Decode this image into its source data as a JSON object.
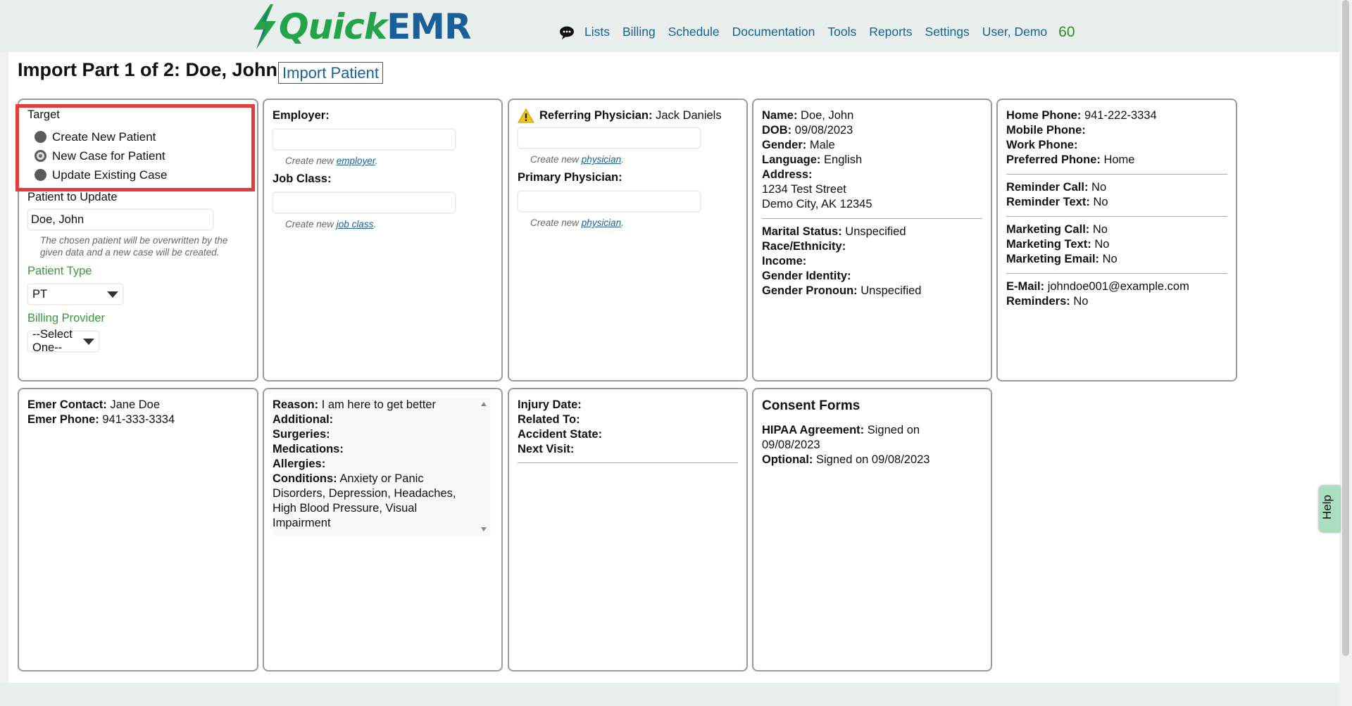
{
  "header": {
    "logo": {
      "quick": "Quick",
      "emr": "EMR"
    },
    "nav": [
      "Lists",
      "Billing",
      "Schedule",
      "Documentation",
      "Tools",
      "Reports",
      "Settings",
      "User, Demo"
    ],
    "count": "60"
  },
  "page": {
    "title": "Import Part 1 of 2: Doe, John",
    "import_button": "Import Patient"
  },
  "target_panel": {
    "title": "Target",
    "options": [
      "Create New Patient",
      "New Case for Patient",
      "Update Existing Case"
    ],
    "selected_option": "New Case for Patient",
    "patient_to_update_label": "Patient to Update",
    "patient_to_update_value": "Doe, John",
    "note": "The chosen patient will be overwritten by the given data and a new case will be created.",
    "patient_type_label": "Patient Type",
    "patient_type_value": "PT",
    "billing_provider_label": "Billing Provider",
    "billing_provider_value": "--Select One--"
  },
  "employer_panel": {
    "employer_label": "Employer:",
    "create_prefix": "Create new ",
    "employer_link": "employer",
    "job_class_label": "Job Class:",
    "job_class_link": "job class",
    "period": "."
  },
  "physician_panel": {
    "referring_label": "Referring Physician:",
    "referring_value": "Jack Daniels",
    "create_prefix": "Create new ",
    "physician_link": "physician",
    "primary_label": "Primary Physician:",
    "period": "."
  },
  "demographics": {
    "name_label": "Name:",
    "name": "Doe, John",
    "dob_label": "DOB:",
    "dob": "09/08/2023",
    "gender_label": "Gender:",
    "gender": "Male",
    "language_label": "Language:",
    "language": "English",
    "address_label": "Address:",
    "address_line1": "1234 Test Street",
    "address_line2": "Demo City, AK 12345",
    "marital_label": "Marital Status:",
    "marital": "Unspecified",
    "race_label": "Race/Ethnicity:",
    "income_label": "Income:",
    "gender_identity_label": "Gender Identity:",
    "pronoun_label": "Gender Pronoun:",
    "pronoun": "Unspecified"
  },
  "contact": {
    "home_label": "Home Phone:",
    "home": "941-222-3334",
    "mobile_label": "Mobile Phone:",
    "work_label": "Work Phone:",
    "preferred_label": "Preferred Phone:",
    "preferred": "Home",
    "reminder_call_label": "Reminder Call:",
    "reminder_call": "No",
    "reminder_text_label": "Reminder Text:",
    "reminder_text": "No",
    "marketing_call_label": "Marketing Call:",
    "marketing_call": "No",
    "marketing_text_label": "Marketing Text:",
    "marketing_text": "No",
    "marketing_email_label": "Marketing Email:",
    "marketing_email": "No",
    "email_label": "E-Mail:",
    "email": "johndoe001@example.com",
    "reminders_label": "Reminders:",
    "reminders": "No"
  },
  "emergency": {
    "contact_label": "Emer Contact:",
    "contact": "Jane Doe",
    "phone_label": "Emer Phone:",
    "phone": "941-333-3334"
  },
  "medical": {
    "reason_label": "Reason:",
    "reason": "I am here to get better",
    "additional_label": "Additional:",
    "surgeries_label": "Surgeries:",
    "medications_label": "Medications:",
    "allergies_label": "Allergies:",
    "conditions_label": "Conditions:",
    "conditions": "Anxiety or Panic Disorders, Depression, Headaches, High Blood Pressure, Visual Impairment"
  },
  "injury": {
    "injury_date_label": "Injury Date:",
    "related_label": "Related To:",
    "accident_state_label": "Accident State:",
    "next_visit_label": "Next Visit:"
  },
  "consent": {
    "title": "Consent Forms",
    "hipaa_label": "HIPAA Agreement:",
    "hipaa": "Signed on 09/08/2023",
    "optional_label": "Optional:",
    "optional": "Signed on 09/08/2023"
  },
  "help": "Help"
}
